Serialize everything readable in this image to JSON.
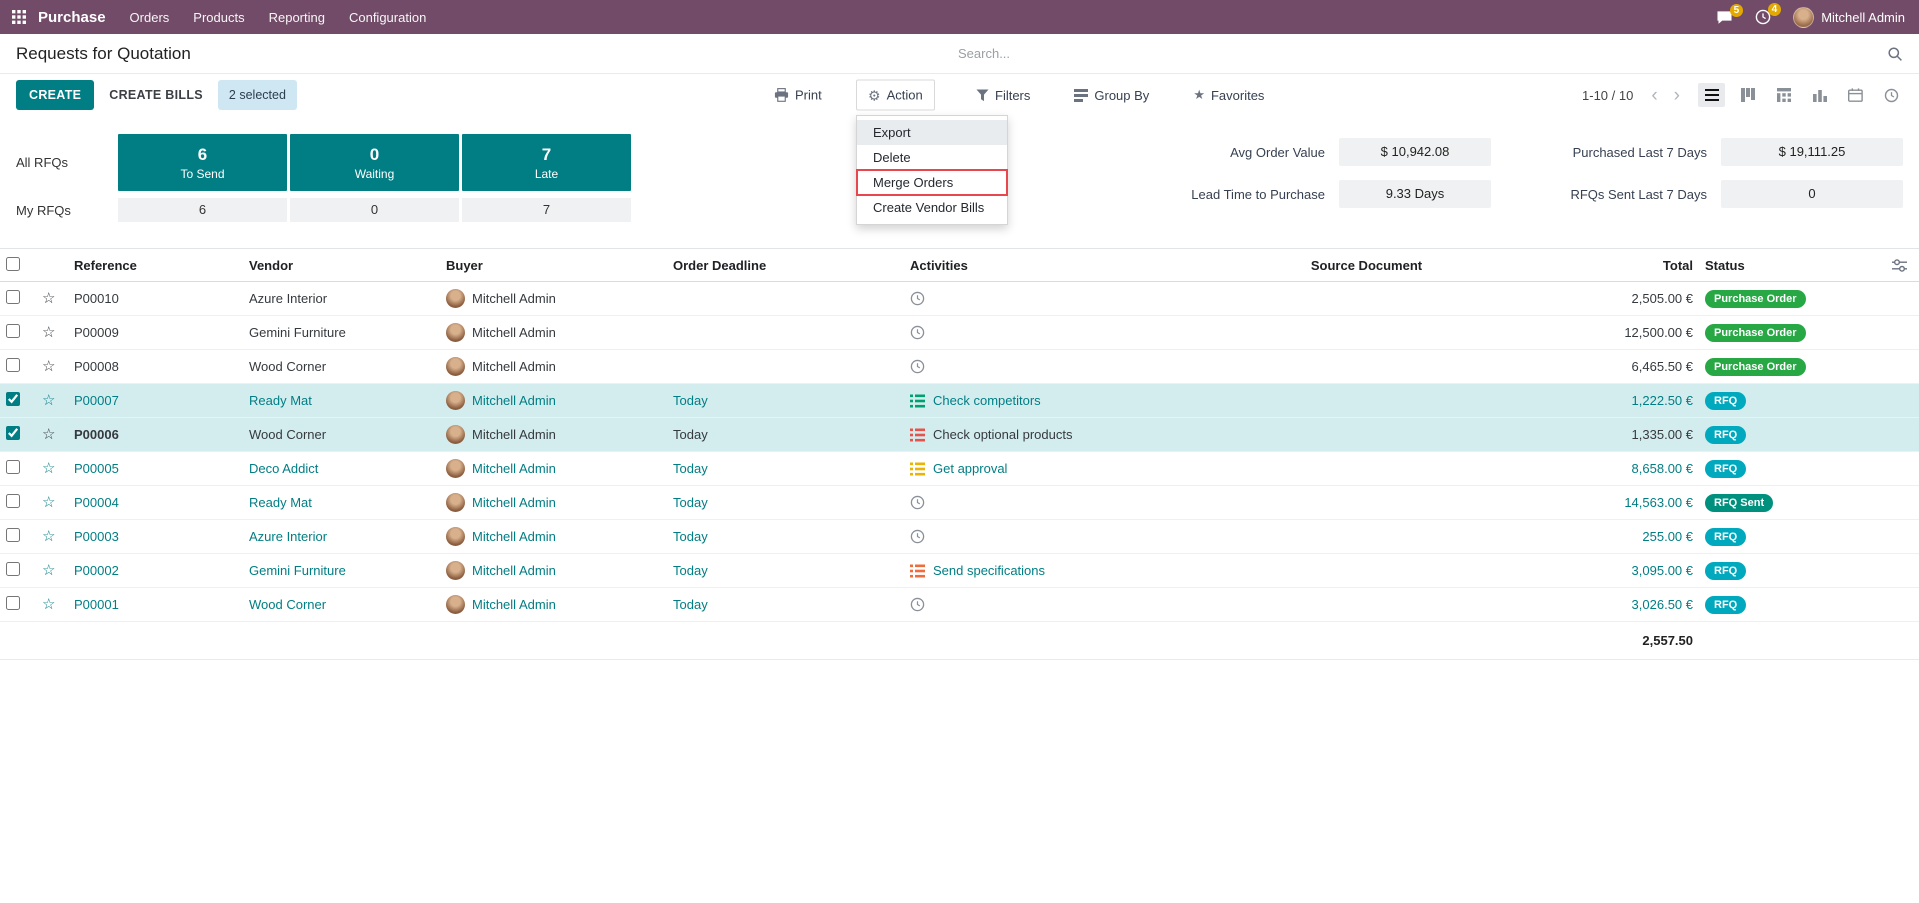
{
  "colors": {
    "navbar_bg": "#714B67",
    "primary": "#017E84",
    "selected_row_bg": "#D3EDEF",
    "systray_badge": "#E4A900",
    "highlight_red": "#E8484D"
  },
  "navbar": {
    "app_name": "Purchase",
    "menus": [
      "Orders",
      "Products",
      "Reporting",
      "Configuration"
    ],
    "messages_count": "5",
    "activities_count": "4",
    "user_name": "Mitchell Admin"
  },
  "breadcrumb": {
    "title": "Requests for Quotation"
  },
  "search": {
    "placeholder": "Search..."
  },
  "control_panel": {
    "create_label": "CREATE",
    "create_bills_label": "CREATE BILLS",
    "selected_badge": "2 selected",
    "print_label": "Print",
    "action_label": "Action",
    "filters_label": "Filters",
    "group_by_label": "Group By",
    "favorites_label": "Favorites",
    "pager": "1-10 / 10"
  },
  "action_menu": {
    "items": [
      {
        "label": "Export"
      },
      {
        "label": "Delete"
      },
      {
        "label": "Merge Orders"
      },
      {
        "label": "Create Vendor Bills"
      }
    ]
  },
  "dashboard": {
    "all_rfqs_label": "All RFQs",
    "my_rfqs_label": "My RFQs",
    "kpis": [
      {
        "value": "6",
        "label": "To Send",
        "my_value": "6"
      },
      {
        "value": "0",
        "label": "Waiting",
        "my_value": "0"
      },
      {
        "value": "7",
        "label": "Late",
        "my_value": "7"
      }
    ],
    "stats": [
      {
        "label": "Avg Order Value",
        "value": "$ 10,942.08"
      },
      {
        "label": "Purchased Last 7 Days",
        "value": "$ 19,111.25"
      },
      {
        "label": "Lead Time to Purchase",
        "value": "9.33 Days"
      },
      {
        "label": "RFQs Sent Last 7 Days",
        "value": "0"
      }
    ]
  },
  "table": {
    "columns": [
      "Reference",
      "Vendor",
      "Buyer",
      "Order Deadline",
      "Activities",
      "Source Document",
      "Total",
      "Status"
    ],
    "footer_total": "2,557.50",
    "rows": [
      {
        "reference": "P00010",
        "vendor": "Azure Interior",
        "buyer": "Mitchell Admin",
        "deadline": "",
        "activity_icon": "clock",
        "activity_text": "",
        "activity_color": "",
        "source_document": "",
        "total": "2,505.00 €",
        "status": "Purchase Order",
        "status_color": "#28A745",
        "selected": false,
        "accent": false,
        "bold_ref": false
      },
      {
        "reference": "P00009",
        "vendor": "Gemini Furniture",
        "buyer": "Mitchell Admin",
        "deadline": "",
        "activity_icon": "clock",
        "activity_text": "",
        "activity_color": "",
        "source_document": "",
        "total": "12,500.00 €",
        "status": "Purchase Order",
        "status_color": "#28A745",
        "selected": false,
        "accent": false,
        "bold_ref": false
      },
      {
        "reference": "P00008",
        "vendor": "Wood Corner",
        "buyer": "Mitchell Admin",
        "deadline": "",
        "activity_icon": "clock",
        "activity_text": "",
        "activity_color": "",
        "source_document": "",
        "total": "6,465.50 €",
        "status": "Purchase Order",
        "status_color": "#28A745",
        "selected": false,
        "accent": false,
        "bold_ref": false
      },
      {
        "reference": "P00007",
        "vendor": "Ready Mat",
        "buyer": "Mitchell Admin",
        "deadline": "Today",
        "activity_icon": "list",
        "activity_text": "Check competitors",
        "activity_color": "#00A070",
        "source_document": "",
        "total": "1,222.50 €",
        "status": "RFQ",
        "status_color": "#00A9BD",
        "selected": true,
        "accent": true,
        "bold_ref": false
      },
      {
        "reference": "P00006",
        "vendor": "Wood Corner",
        "buyer": "Mitchell Admin",
        "deadline": "Today",
        "activity_icon": "list",
        "activity_text": "Check optional products",
        "activity_color": "#E5534B",
        "source_document": "",
        "total": "1,335.00 €",
        "status": "RFQ",
        "status_color": "#00A9BD",
        "selected": true,
        "accent": false,
        "bold_ref": true
      },
      {
        "reference": "P00005",
        "vendor": "Deco Addict",
        "buyer": "Mitchell Admin",
        "deadline": "Today",
        "activity_icon": "list",
        "activity_text": "Get approval",
        "activity_color": "#EAB308",
        "source_document": "",
        "total": "8,658.00 €",
        "status": "RFQ",
        "status_color": "#00A9BD",
        "selected": false,
        "accent": true,
        "bold_ref": false
      },
      {
        "reference": "P00004",
        "vendor": "Ready Mat",
        "buyer": "Mitchell Admin",
        "deadline": "Today",
        "activity_icon": "clock",
        "activity_text": "",
        "activity_color": "",
        "source_document": "",
        "total": "14,563.00 €",
        "status": "RFQ Sent",
        "status_color": "#00917E",
        "selected": false,
        "accent": true,
        "bold_ref": false
      },
      {
        "reference": "P00003",
        "vendor": "Azure Interior",
        "buyer": "Mitchell Admin",
        "deadline": "Today",
        "activity_icon": "clock",
        "activity_text": "",
        "activity_color": "",
        "source_document": "",
        "total": "255.00 €",
        "status": "RFQ",
        "status_color": "#00A9BD",
        "selected": false,
        "accent": true,
        "bold_ref": false
      },
      {
        "reference": "P00002",
        "vendor": "Gemini Furniture",
        "buyer": "Mitchell Admin",
        "deadline": "Today",
        "activity_icon": "list",
        "activity_text": "Send specifications",
        "activity_color": "#EF6C3D",
        "source_document": "",
        "total": "3,095.00 €",
        "status": "RFQ",
        "status_color": "#00A9BD",
        "selected": false,
        "accent": true,
        "bold_ref": false
      },
      {
        "reference": "P00001",
        "vendor": "Wood Corner",
        "buyer": "Mitchell Admin",
        "deadline": "Today",
        "activity_icon": "clock",
        "activity_text": "",
        "activity_color": "",
        "source_document": "",
        "total": "3,026.50 €",
        "status": "RFQ",
        "status_color": "#00A9BD",
        "selected": false,
        "accent": true,
        "bold_ref": false
      }
    ]
  }
}
